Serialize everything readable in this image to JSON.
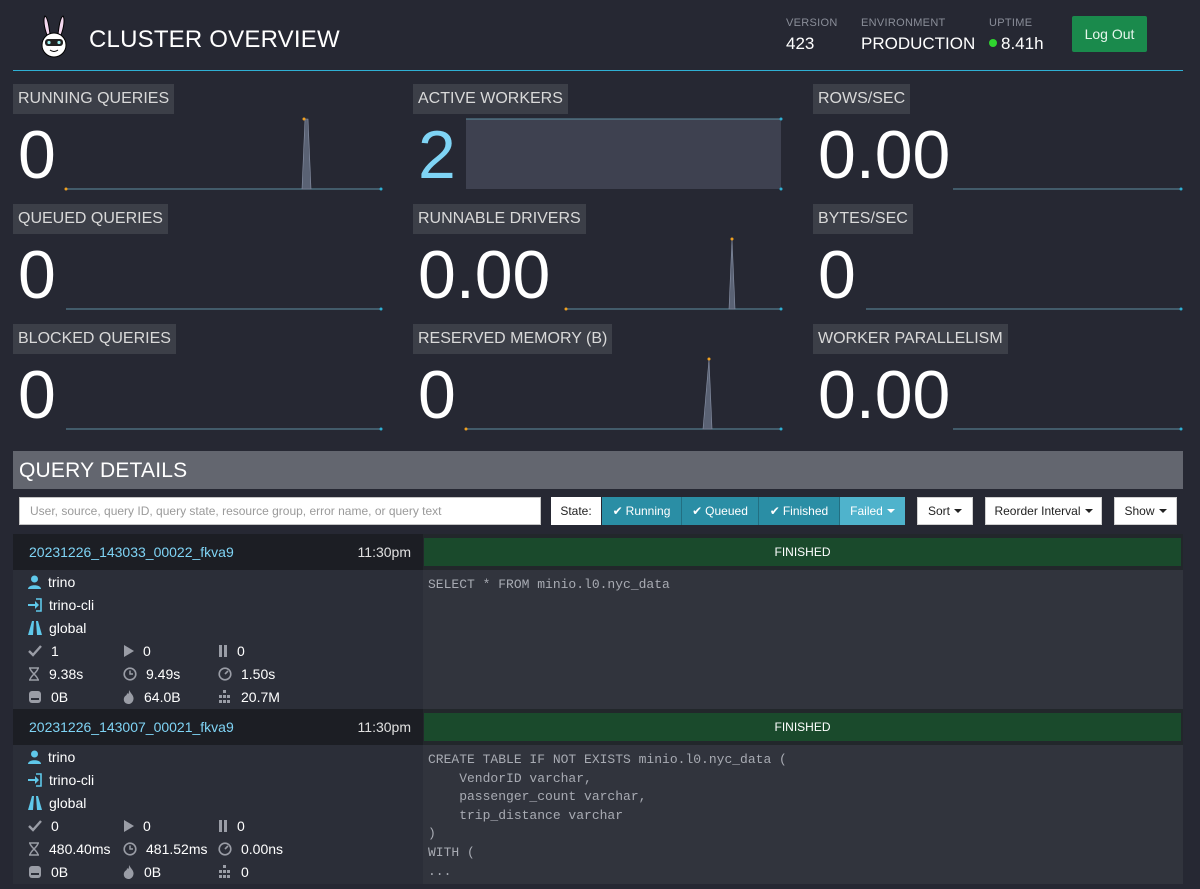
{
  "header": {
    "title": "CLUSTER OVERVIEW",
    "version_label": "VERSION",
    "version": "423",
    "environment_label": "ENVIRONMENT",
    "environment": "PRODUCTION",
    "uptime_label": "UPTIME",
    "uptime": "8.41h",
    "logout_label": "Log Out"
  },
  "tiles": [
    {
      "label": "RUNNING QUERIES",
      "value": "0"
    },
    {
      "label": "ACTIVE WORKERS",
      "value": "2"
    },
    {
      "label": "ROWS/SEC",
      "value": "0.00"
    },
    {
      "label": "QUEUED QUERIES",
      "value": "0"
    },
    {
      "label": "RUNNABLE DRIVERS",
      "value": "0.00"
    },
    {
      "label": "BYTES/SEC",
      "value": "0"
    },
    {
      "label": "BLOCKED QUERIES",
      "value": "0"
    },
    {
      "label": "RESERVED MEMORY (B)",
      "value": "0"
    },
    {
      "label": "WORKER PARALLELISM",
      "value": "0.00"
    }
  ],
  "query_details": {
    "title": "QUERY DETAILS",
    "search_placeholder": "User, source, query ID, query state, resource group, error name, or query text",
    "state_label": "State:",
    "state_running": "Running",
    "state_queued": "Queued",
    "state_finished": "Finished",
    "state_failed": "Failed",
    "sort_label": "Sort",
    "reorder_label": "Reorder Interval",
    "show_label": "Show"
  },
  "queries": [
    {
      "id": "20231226_143033_00022_fkva9",
      "time": "11:30pm",
      "state": "FINISHED",
      "user": "trino",
      "source": "trino-cli",
      "resource_group": "global",
      "completed_splits": "1",
      "running_splits": "0",
      "queued_splits": "0",
      "wall_time": "9.38s",
      "elapsed_time": "9.49s",
      "cpu_time": "1.50s",
      "current_memory": "0B",
      "peak_memory": "64.0B",
      "input_rows": "20.7M",
      "sql": "SELECT * FROM minio.l0.nyc_data"
    },
    {
      "id": "20231226_143007_00021_fkva9",
      "time": "11:30pm",
      "state": "FINISHED",
      "user": "trino",
      "source": "trino-cli",
      "resource_group": "global",
      "completed_splits": "0",
      "running_splits": "0",
      "queued_splits": "0",
      "wall_time": "480.40ms",
      "elapsed_time": "481.52ms",
      "cpu_time": "0.00ns",
      "current_memory": "0B",
      "peak_memory": "0B",
      "input_rows": "0",
      "sql": "CREATE TABLE IF NOT EXISTS minio.l0.nyc_data (\n    VendorID varchar,\n    passenger_count varchar,\n    trip_distance varchar\n)\nWITH (\n..."
    }
  ],
  "colors": {
    "accent": "#2fb0d4",
    "finished": "#1a4a2c",
    "link": "#7fd4f5",
    "logout": "#1a8a4c"
  }
}
